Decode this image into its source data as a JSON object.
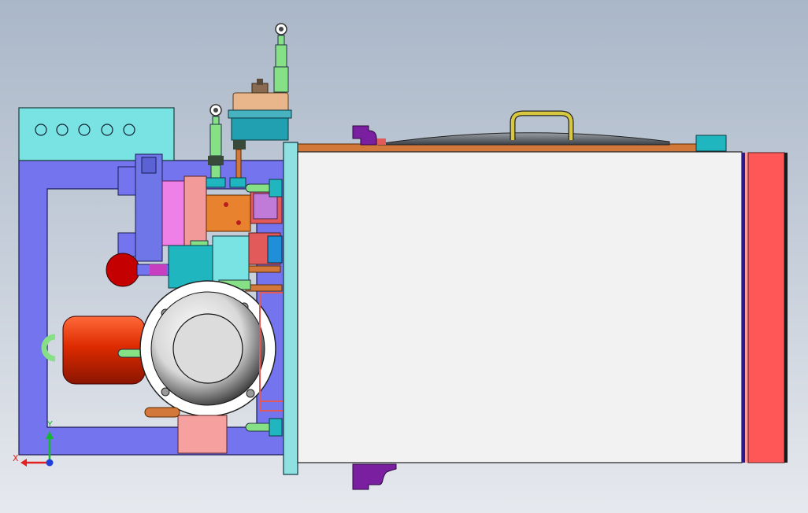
{
  "viewport": {
    "background_top": "#aab7c8",
    "background_bottom": "#e6e9ee"
  },
  "axis_triad": {
    "x_label": "X",
    "y_label": "Y",
    "x_color": "#e32020",
    "y_color": "#14b82e",
    "z_color": "#1f3fd8"
  },
  "colors": {
    "frame": "#7474ee",
    "control_box": "#79e3e3",
    "panel": "#f2f2f2",
    "end_plate": "#ff5757",
    "flange": "#8fe1e1",
    "copper_pipe": "#d2783a",
    "motor": "#dd2a00",
    "pink_block": "#ef80e8",
    "salmon_block": "#f29a9a",
    "orange_block": "#e8822e",
    "teal_block": "#20b6c0",
    "green_fitting": "#86e186",
    "purple_clamp": "#7a1fa0",
    "handle": "#d8c840"
  }
}
